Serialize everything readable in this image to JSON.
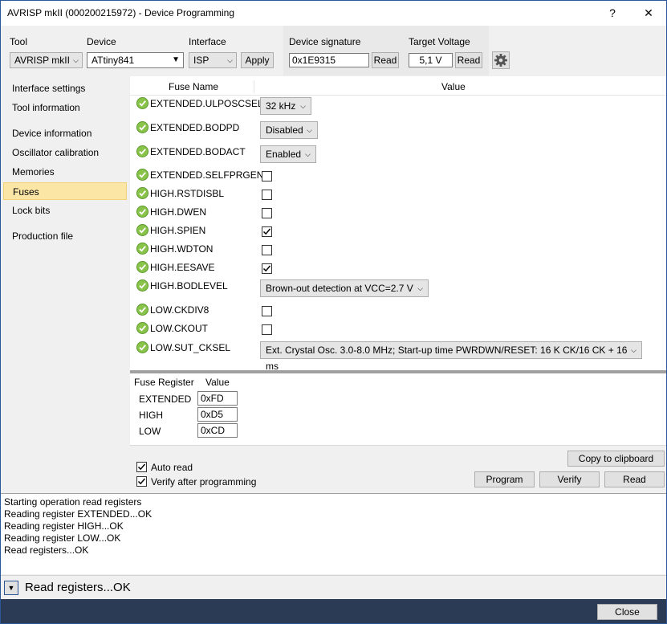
{
  "window": {
    "title": "AVRISP mkII (000200215972) - Device Programming",
    "help": "?",
    "close": "✕"
  },
  "toolbar": {
    "tool_label": "Tool",
    "tool_value": "AVRISP mkII",
    "device_label": "Device",
    "device_value": "ATtiny841",
    "interface_label": "Interface",
    "interface_value": "ISP",
    "apply": "Apply",
    "signature_label": "Device signature",
    "signature_value": "0x1E9315",
    "signature_read": "Read",
    "voltage_label": "Target Voltage",
    "voltage_value": "5,1 V",
    "voltage_read": "Read"
  },
  "sidebar": {
    "items": [
      {
        "label": "Interface settings"
      },
      {
        "label": "Tool information"
      },
      {
        "label": "Device information"
      },
      {
        "label": "Oscillator calibration"
      },
      {
        "label": "Memories"
      },
      {
        "label": "Fuses"
      },
      {
        "label": "Lock bits"
      },
      {
        "label": "Production file"
      }
    ],
    "selected": "Fuses"
  },
  "fuses": {
    "col_name": "Fuse Name",
    "col_value": "Value",
    "rows": [
      {
        "name": "EXTENDED.ULPOSCSEL",
        "kind": "combo",
        "value": "32 kHz"
      },
      {
        "name": "EXTENDED.BODPD",
        "kind": "combo",
        "value": "Disabled"
      },
      {
        "name": "EXTENDED.BODACT",
        "kind": "combo",
        "value": "Enabled"
      },
      {
        "name": "EXTENDED.SELFPRGEN",
        "kind": "check",
        "checked": false
      },
      {
        "name": "HIGH.RSTDISBL",
        "kind": "check",
        "checked": false
      },
      {
        "name": "HIGH.DWEN",
        "kind": "check",
        "checked": false
      },
      {
        "name": "HIGH.SPIEN",
        "kind": "check",
        "checked": true
      },
      {
        "name": "HIGH.WDTON",
        "kind": "check",
        "checked": false
      },
      {
        "name": "HIGH.EESAVE",
        "kind": "check",
        "checked": true
      },
      {
        "name": "HIGH.BODLEVEL",
        "kind": "combo",
        "value": "Brown-out detection at VCC=2.7 V"
      },
      {
        "name": "LOW.CKDIV8",
        "kind": "check",
        "checked": false
      },
      {
        "name": "LOW.CKOUT",
        "kind": "check",
        "checked": false
      },
      {
        "name": "LOW.SUT_CKSEL",
        "kind": "combo",
        "value": "Ext. Crystal Osc. 3.0-8.0 MHz; Start-up time PWRDWN/RESET: 16 K CK/16 CK + 16 ms"
      }
    ]
  },
  "registers": {
    "col_register": "Fuse Register",
    "col_value": "Value",
    "rows": [
      {
        "name": "EXTENDED",
        "value": "0xFD"
      },
      {
        "name": "HIGH",
        "value": "0xD5"
      },
      {
        "name": "LOW",
        "value": "0xCD"
      }
    ]
  },
  "options": {
    "auto_read": "Auto read",
    "verify_after": "Verify after programming",
    "copy": "Copy to clipboard",
    "program": "Program",
    "verify": "Verify",
    "read": "Read"
  },
  "log": [
    "Starting operation read registers",
    "Reading register EXTENDED...OK",
    "Reading register HIGH...OK",
    "Reading register LOW...OK",
    "Read registers...OK"
  ],
  "status": {
    "text": "Read registers...OK"
  },
  "footer": {
    "close": "Close"
  },
  "colors": {
    "accent": "#2b5797",
    "selected": "#fbe6a6",
    "footer": "#2b3a55",
    "ok": "#8ac34a"
  }
}
